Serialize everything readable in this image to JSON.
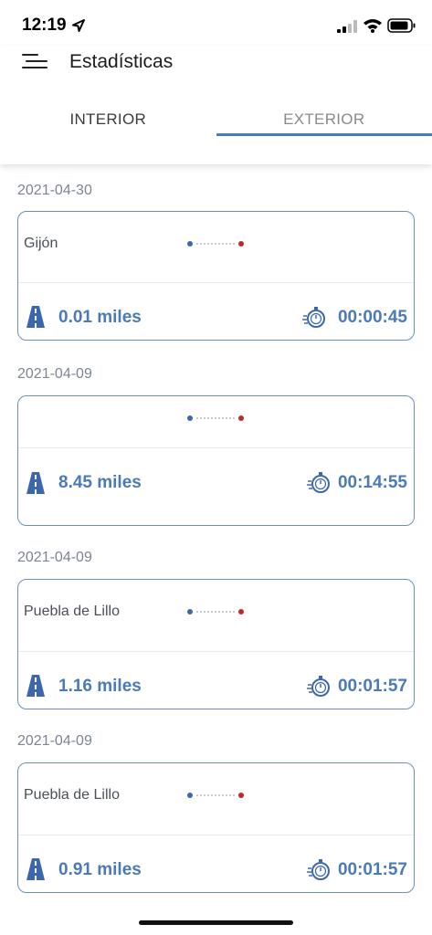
{
  "status_bar": {
    "time": "12:19"
  },
  "header": {
    "title": "Estadísticas"
  },
  "tabs": [
    {
      "label": "INTERIOR",
      "selected": false
    },
    {
      "label": "EXTERIOR",
      "selected": true
    }
  ],
  "colors": {
    "accent": "#4a7ab8",
    "start_dot": "#3d67ad",
    "end_dot": "#c0282a",
    "card_border": "#6c8fc2"
  },
  "trips": [
    {
      "date": "2021-04-30",
      "place": "Gijón",
      "distance": "0.01 miles",
      "duration": "00:00:45"
    },
    {
      "date": "2021-04-09",
      "place": "",
      "distance": "8.45 miles",
      "duration": "00:14:55"
    },
    {
      "date": "2021-04-09",
      "place": "Puebla de Lillo",
      "distance": "1.16 miles",
      "duration": "00:01:57"
    },
    {
      "date": "2021-04-09",
      "place": "Puebla de Lillo",
      "distance": "0.91 miles",
      "duration": "00:01:57"
    }
  ]
}
